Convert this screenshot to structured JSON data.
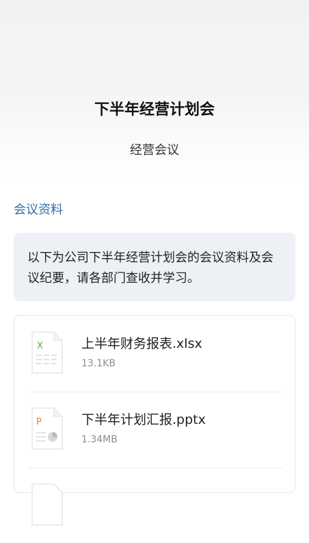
{
  "header": {
    "title": "下半年经营计划会",
    "subtitle": "经营会议"
  },
  "section": {
    "label": "会议资料"
  },
  "notice": {
    "text": "以下为公司下半年经营计划会的会议资料及会议纪要，请各部门查收并学习。"
  },
  "files": [
    {
      "name": "上半年财务报表.xlsx",
      "size": "13.1KB",
      "icon": "excel-file-icon",
      "icon_letter": "X",
      "color": "#5fa53f"
    },
    {
      "name": "下半年计划汇报.pptx",
      "size": "1.34MB",
      "icon": "powerpoint-file-icon",
      "icon_letter": "P",
      "color": "#e0823a"
    }
  ]
}
